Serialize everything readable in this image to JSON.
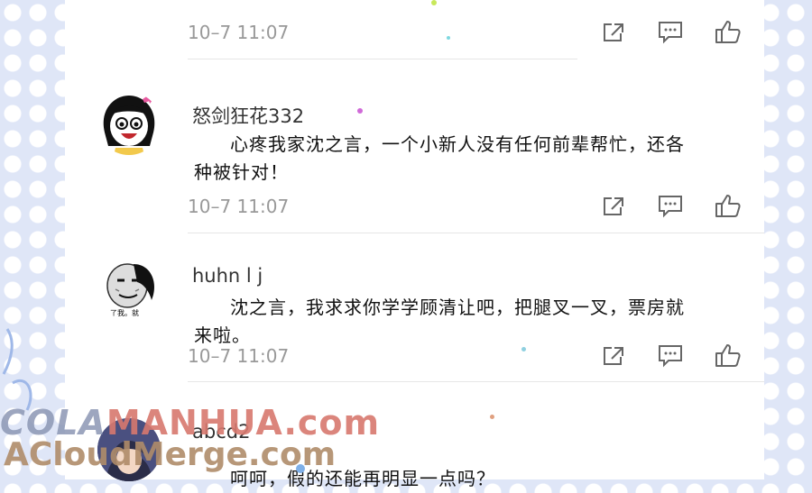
{
  "comments": [
    {
      "username": "",
      "text": "",
      "time": "10–7 11:07"
    },
    {
      "username": "怒剑狂花332",
      "text": "心疼我家沈之言，一个小新人没有任何前辈帮忙，还各种被针对！",
      "time": "10–7 11:07"
    },
    {
      "username": "huhn l j",
      "text": "沈之言，我求求你学学顾清让吧，把腿叉一叉，票房就来啦。",
      "time": "10–7 11:07",
      "avatar_caption": "了我。就"
    },
    {
      "username": "abcd2",
      "text": "呵呵，假的还能再明显一点吗？"
    }
  ],
  "icons": {
    "share": "share-icon",
    "comment": "comment-icon",
    "like": "thumbs-up-icon"
  },
  "watermark": {
    "line1_a": "COLA",
    "line1_b": "MANHUA.com",
    "line2": "ACloudMerge.com"
  },
  "colors": {
    "time_text": "#999999",
    "icon": "#666666",
    "background": "#dfe6f7"
  }
}
